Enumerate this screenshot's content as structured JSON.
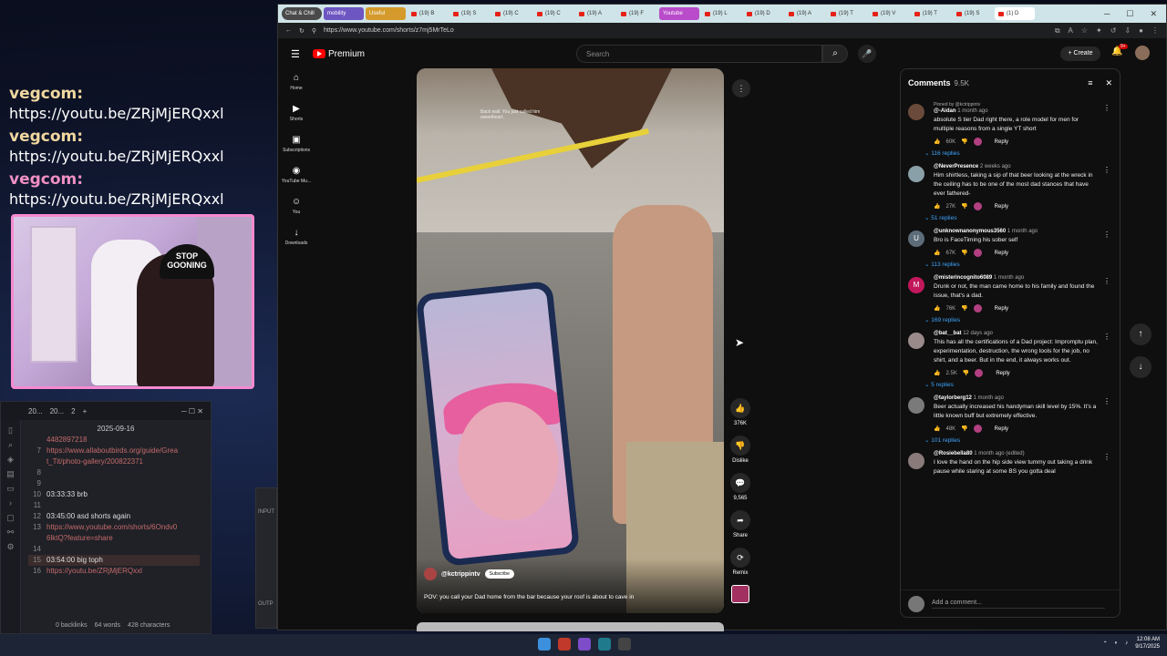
{
  "overlay_chat": [
    {
      "user": "vegcom:",
      "message": "https://youtu.be/ZRjMjERQxxl"
    },
    {
      "user": "vegcom:",
      "message": "https://youtu.be/ZRjMjERQxxl"
    },
    {
      "user": "vegcom:",
      "message": "https://youtu.be/ZRjMjERQxxl"
    }
  ],
  "webcam": {
    "hat_text": "STOP GOONING"
  },
  "notes_app": {
    "tabs": [
      "20...",
      "20...",
      "2"
    ],
    "date": "2025-09-16",
    "lines": [
      {
        "num": "",
        "text": "4482897218",
        "link": true
      },
      {
        "num": "7",
        "text": "https://www.allaboutbirds.org/guide/Grea",
        "link": true
      },
      {
        "num": "",
        "text": "t_Tit/photo-gallery/200822371",
        "link": true
      },
      {
        "num": "8",
        "text": "",
        "link": false
      },
      {
        "num": "9",
        "text": "",
        "link": false
      },
      {
        "num": "10",
        "text": "03:33:33 brb",
        "link": false
      },
      {
        "num": "11",
        "text": "",
        "link": false
      },
      {
        "num": "12",
        "text": "03:45:00 asd shorts again",
        "link": false
      },
      {
        "num": "13",
        "text": "https://www.youtube.com/shorts/6Ondv0",
        "link": true
      },
      {
        "num": "",
        "text": "6lktQ?feature=share",
        "link": true
      },
      {
        "num": "14",
        "text": "",
        "link": false
      },
      {
        "num": "15",
        "text": "03:54:00 big toph",
        "link": false
      },
      {
        "num": "16",
        "text": "https://youtu.be/ZRjMjERQxxl",
        "link": true
      }
    ],
    "status": {
      "backlinks": "0 backlinks",
      "words": "64 words",
      "chars": "428 characters"
    }
  },
  "obs_partial": {
    "label_top": "INPUT",
    "label_bottom": "OUTP"
  },
  "browser": {
    "tabs": [
      {
        "label": "Chat & Chill",
        "style": "group"
      },
      {
        "label": "mobility",
        "style": "purple"
      },
      {
        "label": "Useful",
        "style": "orange"
      },
      {
        "label": "(19) B",
        "style": ""
      },
      {
        "label": "(19) S",
        "style": ""
      },
      {
        "label": "(19) C",
        "style": ""
      },
      {
        "label": "(19) C",
        "style": ""
      },
      {
        "label": "(19) A",
        "style": ""
      },
      {
        "label": "(19) F",
        "style": ""
      },
      {
        "label": "Youtube",
        "style": "pink"
      },
      {
        "label": "(19) L",
        "style": ""
      },
      {
        "label": "(19) D",
        "style": ""
      },
      {
        "label": "(19) A",
        "style": ""
      },
      {
        "label": "(19) T",
        "style": ""
      },
      {
        "label": "(19) V",
        "style": ""
      },
      {
        "label": "(19) T",
        "style": ""
      },
      {
        "label": "(19) S",
        "style": ""
      },
      {
        "label": "(1) D",
        "style": "active"
      }
    ],
    "url": "https://www.youtube.com/shorts/z7mj5MrTeLo"
  },
  "youtube": {
    "logo_text": "Premium",
    "search_placeholder": "Search",
    "create_label": "Create",
    "notif_badge": "9+",
    "left_nav": [
      {
        "icon": "home-icon",
        "glyph": "⌂",
        "label": "Home"
      },
      {
        "icon": "shorts-icon",
        "glyph": "▶",
        "label": "Shorts"
      },
      {
        "icon": "subscriptions-icon",
        "glyph": "▣",
        "label": "Subscriptions"
      },
      {
        "icon": "youtube-music-icon",
        "glyph": "◉",
        "label": "YouTube Mu..."
      },
      {
        "icon": "you-icon",
        "glyph": "☺",
        "label": "You"
      },
      {
        "icon": "downloads-icon",
        "glyph": "↓",
        "label": "Downloads"
      }
    ],
    "short": {
      "burned_caption": "Back wall. You just called him sweetheart.",
      "channel": "@kctrippintv",
      "subscribe_label": "Subscribe",
      "caption": "POV: you call your Dad home from the bar because your roof is about to cave in"
    },
    "actions": [
      {
        "icon": "like-icon",
        "glyph": "👍",
        "label": "376K"
      },
      {
        "icon": "dislike-icon",
        "glyph": "👎",
        "label": "Dislike"
      },
      {
        "icon": "comment-icon",
        "glyph": "💬",
        "label": "9,565"
      },
      {
        "icon": "share-icon",
        "glyph": "➦",
        "label": "Share"
      },
      {
        "icon": "remix-icon",
        "glyph": "⟳",
        "label": "Remix"
      }
    ],
    "comments": {
      "title": "Comments",
      "count": "9.5K",
      "add_placeholder": "Add a comment...",
      "reply_label": "Reply",
      "items": [
        {
          "pinned": "Pinned by @kctrippintv",
          "author": "@-Aidan",
          "ago": "1 month ago",
          "text": "absolute S tier Dad right there, a role model for men for multiple reasons from a single YT short",
          "likes": "60K",
          "replies": "116 replies",
          "avatar_color": "#6a4a3a",
          "avatar_letter": ""
        },
        {
          "pinned": "",
          "author": "@NeverPresence",
          "ago": "2 weeks ago",
          "text": "Him shirtless, taking a sip of that beer looking at the wreck in the ceiling has to be one of the most dad stances that have ever fathered-",
          "likes": "27K",
          "replies": "51 replies",
          "avatar_color": "#8aa0a8",
          "avatar_letter": ""
        },
        {
          "pinned": "",
          "author": "@unknownanonymous3560",
          "ago": "1 month ago",
          "text": "Bro is FaceTiming his sober self",
          "likes": "67K",
          "replies": "113 replies",
          "avatar_color": "#5d6d7a",
          "avatar_letter": "U"
        },
        {
          "pinned": "",
          "author": "@misterincognito6089",
          "ago": "1 month ago",
          "text": "Drunk or not, the man came home to his family and found the issue, that's a dad.",
          "likes": "76K",
          "replies": "169 replies",
          "avatar_color": "#c2185b",
          "avatar_letter": "M"
        },
        {
          "pinned": "",
          "author": "@bat__bat",
          "ago": "12 days ago",
          "text": "This has all the certifications of a Dad project: Impromptu plan, experimentation, destruction, the wrong tools for the job, no shirt, and a beer. But in the end, it always works out.",
          "likes": "2.5K",
          "replies": "5 replies",
          "avatar_color": "#9a8a8a",
          "avatar_letter": ""
        },
        {
          "pinned": "",
          "author": "@taylorberg12",
          "ago": "1 month ago",
          "text": "Beer actually increased his handyman skill level by 15%. It's a little known buff but extremely effective.",
          "likes": "48K",
          "replies": "101 replies",
          "avatar_color": "#7a7a7a",
          "avatar_letter": ""
        },
        {
          "pinned": "",
          "author": "@Rosiebella80",
          "ago": "1 month ago (edited)",
          "text": "I love the hand on the hip side view tummy out taking a drink pause while staring at some BS you gotta deal",
          "likes": "",
          "replies": "",
          "avatar_color": "#8a7a7a",
          "avatar_letter": ""
        }
      ]
    }
  },
  "taskbar": {
    "time": "12:08 AM",
    "date": "9/17/2025"
  }
}
